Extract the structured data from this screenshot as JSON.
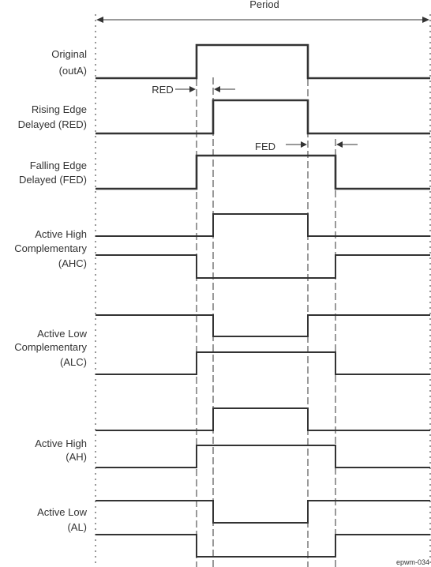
{
  "period_label": "Period",
  "red_label": "RED",
  "fed_label": "FED",
  "figure_id": "epwm-034",
  "segment_note": "levels per interval between the four guide edges",
  "signals": [
    {
      "label_lines": [
        "Original",
        "(outA)"
      ],
      "traces": [
        [
          0,
          1,
          1,
          0,
          0
        ]
      ]
    },
    {
      "label_lines": [
        "Rising Edge",
        "Delayed (RED)"
      ],
      "traces": [
        [
          0,
          0,
          1,
          0,
          0
        ]
      ]
    },
    {
      "label_lines": [
        "Falling Edge",
        "Delayed (FED)"
      ],
      "traces": [
        [
          0,
          1,
          1,
          1,
          0
        ]
      ]
    },
    {
      "label_lines": [
        "Active High",
        "Complementary",
        "(AHC)"
      ],
      "traces": [
        [
          0,
          0,
          1,
          0,
          0
        ],
        [
          1,
          0,
          0,
          0,
          1
        ]
      ]
    },
    {
      "label_lines": [
        "Active Low",
        "Complementary",
        "(ALC)"
      ],
      "traces": [
        [
          1,
          1,
          0,
          1,
          1
        ],
        [
          0,
          1,
          1,
          1,
          0
        ]
      ]
    },
    {
      "label_lines": [
        "Active High",
        "(AH)"
      ],
      "traces": [
        [
          0,
          0,
          1,
          0,
          0
        ],
        [
          0,
          1,
          1,
          1,
          0
        ]
      ]
    },
    {
      "label_lines": [
        "Active Low",
        "(AL)"
      ],
      "traces": [
        [
          1,
          1,
          0,
          1,
          1
        ],
        [
          1,
          0,
          0,
          0,
          1
        ]
      ]
    }
  ]
}
